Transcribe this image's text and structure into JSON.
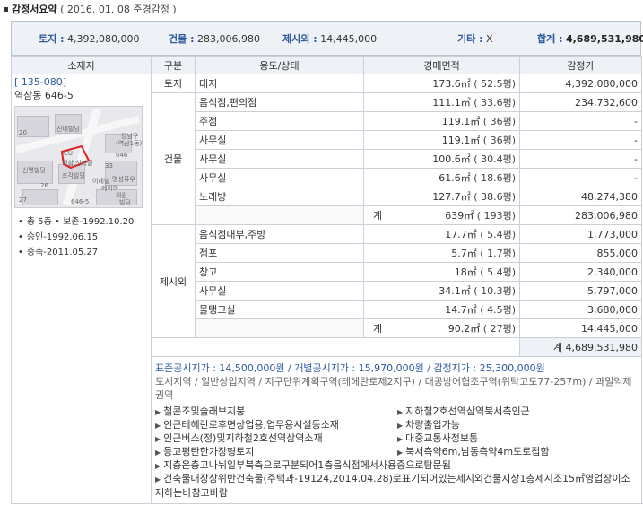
{
  "header": {
    "title": "감정서요약",
    "subtitle": "( 2016. 01. 08  준경감정 )"
  },
  "summary": {
    "land_label": "토지 :",
    "land_value": "4,392,080,000",
    "building_label": "건물 :",
    "building_value": "283,006,980",
    "extra_label": "제시외 :",
    "extra_value": "14,445,000",
    "other_label": "기타 :",
    "other_value": "X",
    "total_label": "합계 :",
    "total_value": "4,689,531,980"
  },
  "columns": [
    "소재지",
    "구분",
    "용도/상태",
    "경매면적",
    "감정가"
  ],
  "location": {
    "code": "[ 135-080]",
    "address": "역삼동 646-5",
    "map_labels": [
      "20",
      "진네빌딩",
      "CU",
      "역삼·신라빌",
      "신명빌딩",
      "조각빌딩",
      "이레빌",
      "646",
      "646-5",
      "26",
      "33",
      "에이하",
      "명성퓨우",
      "의원",
      "27",
      "빌딩",
      "(역삼1동)",
      "강남구"
    ],
    "bullets": [
      "총 5층  • 보존-1992.10.20",
      "승인-1992.06.15",
      "증축-2011.05.27"
    ]
  },
  "land": {
    "category": "토지",
    "use": "대지",
    "area": "173.6㎡",
    "pyeong": "( 52.5평)",
    "price": "4,392,080,000"
  },
  "building": {
    "category": "건물",
    "rows": [
      {
        "use": "음식점,편의점",
        "area": "111.1㎡",
        "pyeong": "( 33.6평)",
        "price": "234,732,600"
      },
      {
        "use": "주점",
        "area": "119.1㎡",
        "pyeong": "( 36평)",
        "price": "-"
      },
      {
        "use": "사무실",
        "area": "119.1㎡",
        "pyeong": "( 36평)",
        "price": "-"
      },
      {
        "use": "사무실",
        "area": "100.6㎡",
        "pyeong": "( 30.4평)",
        "price": "-"
      },
      {
        "use": "사무실",
        "area": "61.6㎡",
        "pyeong": "( 18.6평)",
        "price": "-"
      },
      {
        "use": "노래방",
        "area": "127.7㎡",
        "pyeong": "( 38.6평)",
        "price": "48,274,380"
      }
    ],
    "subtotal": {
      "label": "계",
      "area": "639㎡",
      "pyeong": "( 193평)",
      "price": "283,006,980"
    }
  },
  "extra": {
    "category": "제시외",
    "rows": [
      {
        "use": "음식점내부,주방",
        "area": "17.7㎡",
        "pyeong": "( 5.4평)",
        "price": "1,773,000"
      },
      {
        "use": "점포",
        "area": "5.7㎡",
        "pyeong": "( 1.7평)",
        "price": "855,000"
      },
      {
        "use": "창고",
        "area": "18㎡",
        "pyeong": "( 5.4평)",
        "price": "2,340,000"
      },
      {
        "use": "사무실",
        "area": "34.1㎡",
        "pyeong": "( 10.3평)",
        "price": "5,797,000"
      },
      {
        "use": "물탱크실",
        "area": "14.7㎡",
        "pyeong": "( 4.5평)",
        "price": "3,680,000"
      }
    ],
    "subtotal": {
      "label": "계",
      "area": "90.2㎡",
      "pyeong": "( 27평)",
      "price": "14,445,000"
    }
  },
  "grand_total": "계  4,689,531,980",
  "notes": {
    "line1": "표준공시지가 : 14,500,000원 / 개별공시지가 : 15,970,000원 / 감정지가 : 25,300,000원",
    "line2": "도시지역 / 일반상업지역 / 지구단위계획구역(테헤란로제2지구) / 대공방어협조구역(위탁고도77-257m) / 과밀억제권역",
    "pairs": [
      [
        "철콘조및슬래브지붕",
        "지하철2호선역삼역북서측인근"
      ],
      [
        "인근테헤란로후면상업용,업무용시설등소재",
        "차량출입가능"
      ],
      [
        "인근버스(정)및지하철2호선역삼역소재",
        "대중교통사정보통"
      ],
      [
        "등고평탄한가장형토지",
        "북서측약6m,남동측약4m도로접함"
      ]
    ],
    "single1": "지층은층고나뉘일부북측으로구분되어1층음식점에서사용중으로탐문됨",
    "single2": "건축물대장상위반건축물(주택과-19124,2014.04.28)로표기되어있는제시외건물지상1층세시조15㎡영업장이소재하는바참고바람"
  }
}
